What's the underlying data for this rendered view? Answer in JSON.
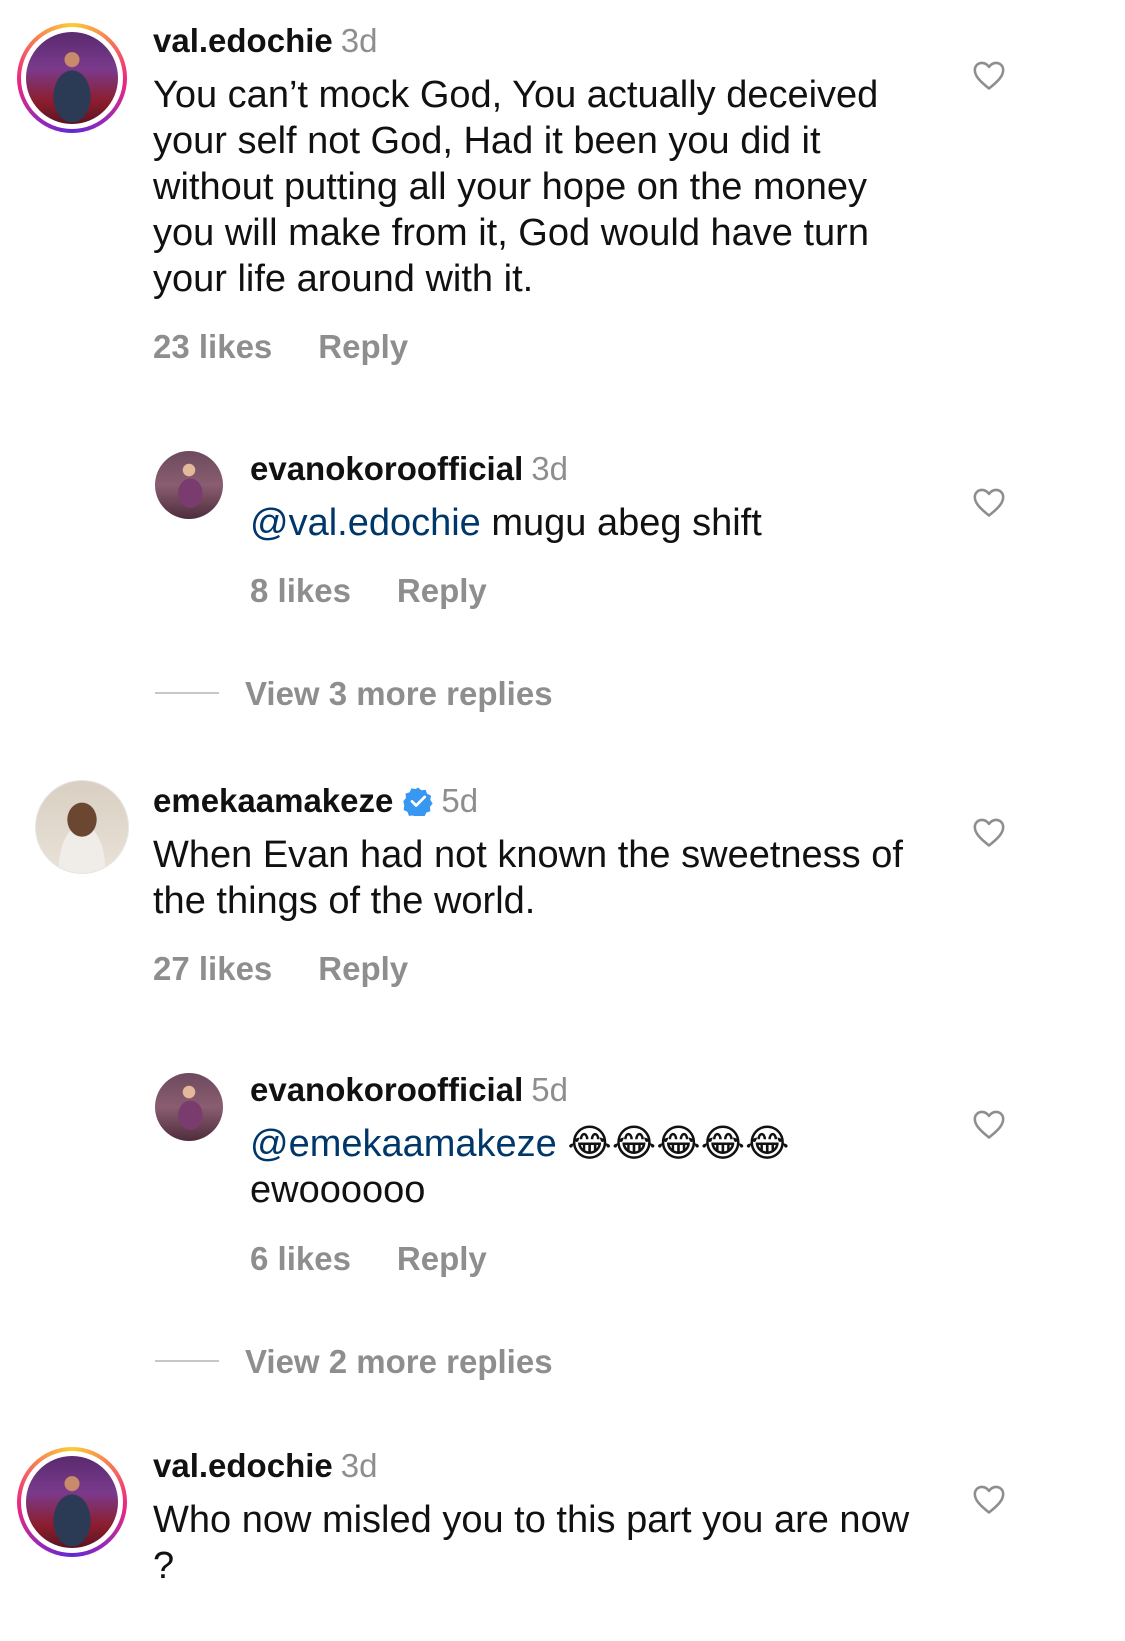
{
  "comments": [
    {
      "username": "val.edochie",
      "time": "3d",
      "text": "You can’t mock God, You actually deceived your self not God, Had it been you did it without putting all your hope on the money you will make from it, God would have turn your life around with it.",
      "likes": "23 likes",
      "reply": "Reply"
    },
    {
      "username": "evanokoroofficial",
      "time": "3d",
      "mention": "@val.edochie",
      "text": " mugu abeg shift",
      "likes": "8 likes",
      "reply": "Reply"
    },
    {
      "view_more": "View 3 more replies"
    },
    {
      "username": "emekaamakeze",
      "time": "5d",
      "text": "When Evan had not known the sweetness of the things of the world.",
      "likes": "27 likes",
      "reply": "Reply"
    },
    {
      "username": "evanokoroofficial",
      "time": "5d",
      "mention": "@emekaamakeze",
      "text": " 😂😂😂😂😂 ewoooooo",
      "likes": "6 likes",
      "reply": "Reply"
    },
    {
      "view_more": "View 2 more replies"
    },
    {
      "username": "val.edochie",
      "time": "3d",
      "text": "Who now misled you to this part you are now ?"
    }
  ],
  "icons": {
    "heart": "heart-outline-icon",
    "verified": "verified-badge-icon"
  },
  "colors": {
    "mention": "#00376b",
    "muted": "#8e8e8e",
    "verified": "#3897f0"
  }
}
